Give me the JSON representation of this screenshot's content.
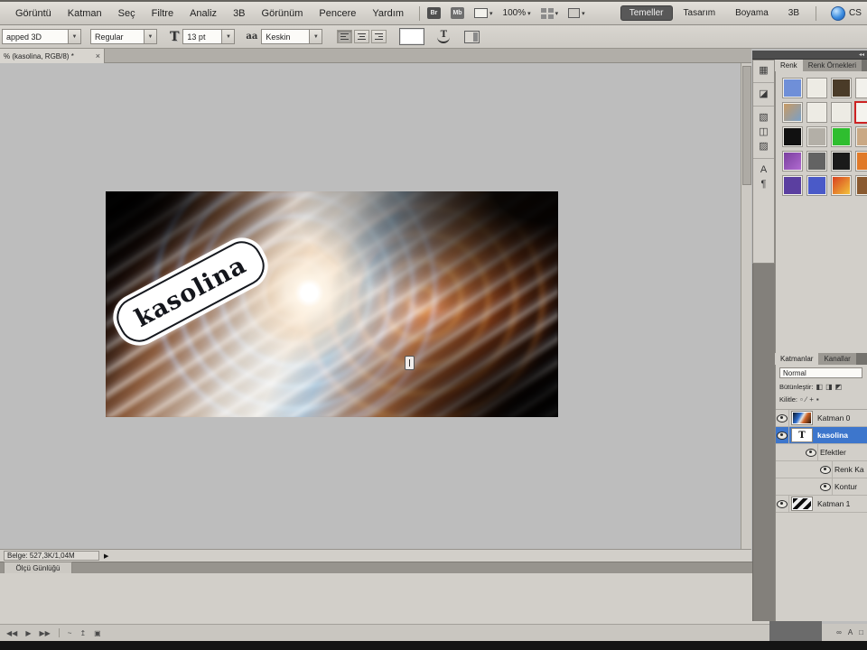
{
  "menu_bar": {
    "menus": [
      "Görüntü",
      "Katman",
      "Seç",
      "Filtre",
      "Analiz",
      "3B",
      "Görünüm",
      "Pencere",
      "Yardım"
    ],
    "bridge_label": "Br",
    "mini_bridge_label": "Mb",
    "zoom_level": "100%",
    "workspaces": [
      "Temeller",
      "Tasarım",
      "Boyama",
      "3B"
    ],
    "active_workspace": "Temeller",
    "cs_live_label": "CS"
  },
  "options_bar": {
    "font_family": "apped 3D",
    "font_style": "Regular",
    "font_size": "13 pt",
    "anti_alias": "Keskin"
  },
  "document": {
    "tab_title": "% (kasolina, RGB/8) *",
    "close_label": "×",
    "status_info": "Belge: 527,3K/1,04M",
    "canvas_text": "kasolina"
  },
  "bottom_panel": {
    "tab_label": "Ölçü Günlüğü",
    "toolbar_icons": [
      {
        "name": "step-back-icon",
        "glyph": "◀◀"
      },
      {
        "name": "play-icon",
        "glyph": "▶"
      },
      {
        "name": "step-forward-icon",
        "glyph": "▶▶"
      },
      {
        "name": "divider",
        "glyph": ""
      },
      {
        "name": "curve-icon",
        "glyph": "~"
      },
      {
        "name": "export-icon",
        "glyph": "↥"
      },
      {
        "name": "delete-icon",
        "glyph": "▣"
      }
    ]
  },
  "right_dock": {
    "icon_strip": [
      {
        "name": "histogram-panel-icon",
        "glyph": "▦",
        "sep_after": true
      },
      {
        "name": "info-panel-icon",
        "glyph": "◪",
        "sep_after": true
      },
      {
        "name": "adjustments-panel-icon",
        "glyph": "▧",
        "sep_after": false
      },
      {
        "name": "masks-panel-icon",
        "glyph": "◫",
        "sep_after": false
      },
      {
        "name": "styles-panel-icon",
        "glyph": "▨",
        "sep_after": true
      },
      {
        "name": "character-panel-icon",
        "glyph": "A",
        "sep_after": false
      },
      {
        "name": "paragraph-panel-icon",
        "glyph": "¶",
        "sep_after": false
      }
    ],
    "color_panel": {
      "tabs": [
        "Renk",
        "Renk Örnekleri"
      ],
      "active_tab": "Renk",
      "styles": [
        {
          "color": "#6f8fd8"
        },
        {
          "color": "#edebe4"
        },
        {
          "color": "#4a3b28"
        },
        {
          "color": "#f2f1ec"
        },
        {
          "color": "#c89a62",
          "color2": "#7aa0c8"
        },
        {
          "color": "#edebe4"
        },
        {
          "color": "#edebe4"
        },
        {
          "color": "#f4f3ee",
          "selected": true
        },
        {
          "color": "#111111"
        },
        {
          "color": "#b3afa7"
        },
        {
          "color": "#2fbe2f"
        },
        {
          "color": "#c9a884"
        },
        {
          "color": "#7a3f9e",
          "color2": "#b06ad0"
        },
        {
          "color": "#636363"
        },
        {
          "color": "#1a1a1a"
        },
        {
          "color": "#e07a28"
        },
        {
          "color": "#5b3fa0"
        },
        {
          "color": "#4a5ac8"
        },
        {
          "color": "#d84020",
          "color2": "#f2c23a"
        },
        {
          "color": "#8a5a30"
        }
      ]
    },
    "layers_panel": {
      "tabs": [
        "Katmanlar",
        "Kanallar"
      ],
      "active_tab": "Katmanlar",
      "blend_mode": "Normal",
      "blend_row_label": "Bütünleştir:",
      "blend_row_icons": [
        {
          "name": "blend-lock-1-icon",
          "glyph": "◧"
        },
        {
          "name": "blend-lock-2-icon",
          "glyph": "◨"
        },
        {
          "name": "blend-lock-3-icon",
          "glyph": "◩"
        }
      ],
      "lock_row_label": "Kilitle:",
      "lock_row_icons": [
        {
          "name": "lock-transparency-icon",
          "glyph": "▫"
        },
        {
          "name": "lock-paint-icon",
          "glyph": "∕"
        },
        {
          "name": "lock-position-icon",
          "glyph": "+"
        },
        {
          "name": "lock-all-icon",
          "glyph": "▪"
        }
      ],
      "layers": [
        {
          "name": "Katman 0",
          "thumb": "image",
          "indent": 0,
          "selected": false
        },
        {
          "name": "kasolina",
          "thumb": "text",
          "indent": 0,
          "selected": true
        },
        {
          "name": "Efektler",
          "thumb": "none",
          "indent": 32,
          "selected": false
        },
        {
          "name": "Renk Ka",
          "thumb": "none",
          "indent": 48,
          "selected": false
        },
        {
          "name": "Kontur",
          "thumb": "none",
          "indent": 48,
          "selected": false
        },
        {
          "name": "Katman 1",
          "thumb": "bw",
          "indent": 0,
          "selected": false
        }
      ]
    },
    "footer_icons": [
      {
        "name": "link-layers-icon",
        "glyph": "∞"
      },
      {
        "name": "character-icon",
        "glyph": "A"
      },
      {
        "name": "new-layer-icon",
        "glyph": "□"
      }
    ]
  }
}
